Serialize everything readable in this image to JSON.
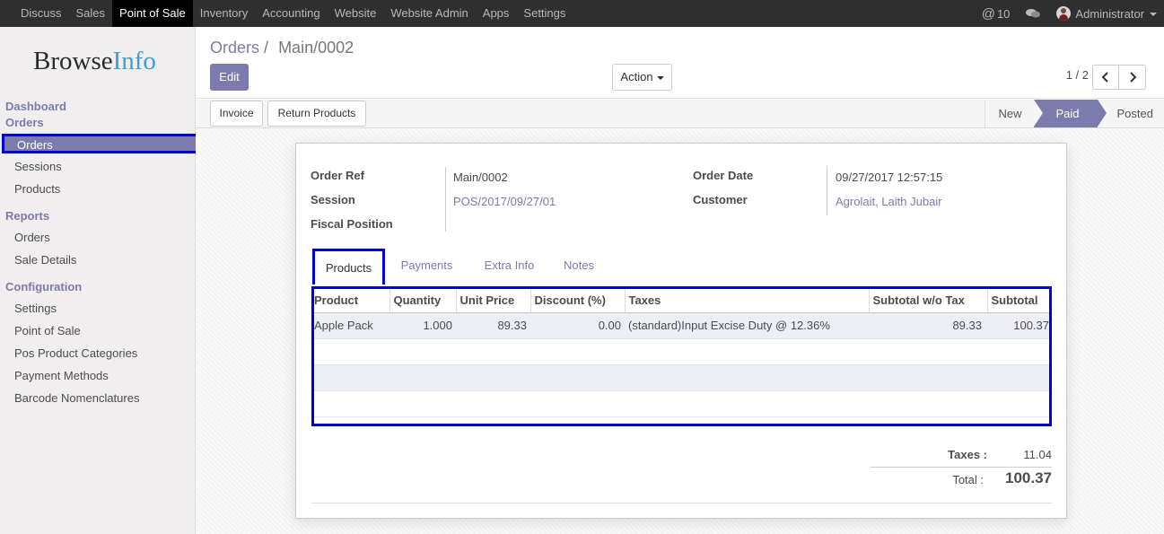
{
  "topbar": {
    "menu": [
      "Discuss",
      "Sales",
      "Point of Sale",
      "Inventory",
      "Accounting",
      "Website",
      "Website Admin",
      "Apps",
      "Settings"
    ],
    "active_index": 2,
    "mentions": "10",
    "user": "Administrator"
  },
  "sidebar": {
    "logo_a": "Browse",
    "logo_b": "Info",
    "dashboard": "Dashboard",
    "orders_section": "Orders",
    "orders_items": [
      "Orders",
      "Sessions",
      "Products"
    ],
    "reports_section": "Reports",
    "reports_items": [
      "Orders",
      "Sale Details"
    ],
    "config_section": "Configuration",
    "config_items": [
      "Settings",
      "Point of Sale",
      "Pos Product Categories",
      "Payment Methods",
      "Barcode Nomenclatures"
    ]
  },
  "control": {
    "breadcrumb_parent": "Orders",
    "breadcrumb_sep": "/",
    "breadcrumb_current": "Main/0002",
    "edit_label": "Edit",
    "action_label": "Action",
    "pager": "1 / 2"
  },
  "statusbar": {
    "invoice_label": "Invoice",
    "return_label": "Return Products",
    "stages": [
      "New",
      "Paid",
      "Posted"
    ]
  },
  "form": {
    "order_ref_label": "Order Ref",
    "order_ref": "Main/0002",
    "session_label": "Session",
    "session": "POS/2017/09/27/01",
    "fiscal_label": "Fiscal Position",
    "order_date_label": "Order Date",
    "order_date": "09/27/2017 12:57:15",
    "customer_label": "Customer",
    "customer": "Agrolait, Laith Jubair"
  },
  "tabs": [
    "Products",
    "Payments",
    "Extra Info",
    "Notes"
  ],
  "table": {
    "headers": [
      "Product",
      "Quantity",
      "Unit Price",
      "Discount (%)",
      "Taxes",
      "Subtotal w/o Tax",
      "Subtotal"
    ],
    "rows": [
      [
        "Apple Pack",
        "1.000",
        "89.33",
        "0.00",
        "(standard)Input Excise Duty @ 12.36%",
        "89.33",
        "100.37"
      ]
    ]
  },
  "totals": {
    "taxes_label": "Taxes :",
    "taxes": "11.04",
    "total_label": "Total :",
    "total": "100.37"
  },
  "colors": {
    "accent": "#7c7bad",
    "highlight_box": "#0000d8",
    "topbar": "#2f2f2f"
  }
}
